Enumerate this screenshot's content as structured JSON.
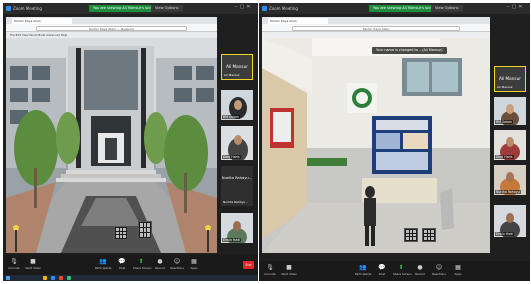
{
  "left_window": {
    "title": "Zoom Meeting",
    "banner": "You are viewing Ali Mansur's screen",
    "view_options": "View Options",
    "address_bar": "Kantor Kaya Alam — Jayapura",
    "viewer_toolbar": "File  Edit  View  World  Build  Advanced  Help",
    "participants": [
      {
        "name": "Ali Mansur",
        "subname": "Ali Mansur",
        "kind": "name-card",
        "active": true
      },
      {
        "name": "RM Salam",
        "kind": "video"
      },
      {
        "name": "Dodi Haris",
        "kind": "video"
      },
      {
        "name": "Nurlita Rahayu...",
        "subname": "Nurlita Rahayu...",
        "kind": "name-card"
      },
      {
        "name": "Erwin Hadi",
        "kind": "video"
      }
    ],
    "toolbar": {
      "mute": "Unmute",
      "video": "Start Video",
      "participants": "Participants",
      "participants_count": "5",
      "chat": "Chat",
      "share": "Share Screen",
      "record": "Record",
      "reactions": "Reactions",
      "apps": "Apps",
      "end": "End"
    }
  },
  "right_window": {
    "title": "Zoom Meeting",
    "banner": "You are viewing Ali Mansur's screen",
    "view_options": "View Options",
    "notice": "Your name is changed to ...(Ali Mansur)",
    "address_bar": "Kantor Kaya Alam",
    "participants": [
      {
        "name": "Ali Mansur",
        "subname": "Ali Mansur",
        "kind": "name-card",
        "active": true
      },
      {
        "name": "RM Salam",
        "kind": "video"
      },
      {
        "name": "Dodi Haris",
        "kind": "video"
      },
      {
        "name": "Nurlita Rahayu",
        "kind": "video"
      },
      {
        "name": "Erwin Hadi",
        "kind": "video"
      }
    ],
    "toolbar": {
      "mute": "Unmute",
      "video": "Start Video",
      "participants": "Participants",
      "chat": "Chat",
      "share": "Share Screen",
      "record": "Record",
      "reactions": "Reactions",
      "apps": "Apps"
    }
  },
  "colors": {
    "zoom_dark": "#1f1f1f",
    "banner_green": "#1e8e3e",
    "active_speaker": "#f5d323",
    "end_red": "#e02828",
    "windows_taskbar": "#202a36"
  },
  "icons": {
    "mute": "microphone-icon",
    "video": "video-camera-icon",
    "participants": "people-icon",
    "chat": "chat-bubble-icon",
    "share": "share-screen-icon",
    "record": "record-icon",
    "reactions": "smile-icon",
    "apps": "apps-grid-icon"
  }
}
